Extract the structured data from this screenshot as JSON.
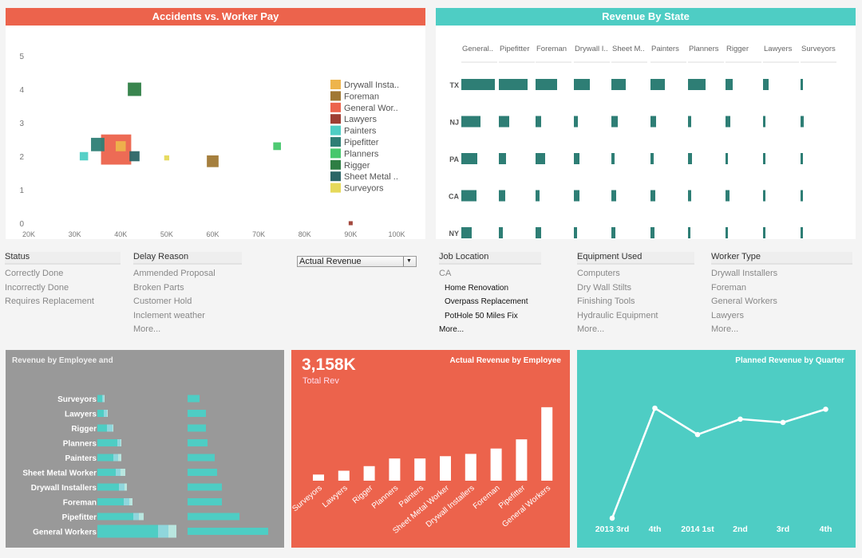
{
  "accidents": {
    "title": "Accidents vs. Worker Pay",
    "chart_data": {
      "type": "scatter",
      "title": "Accidents vs. Worker Pay",
      "xlabel": "",
      "ylabel": "",
      "xlim": [
        20000,
        100000
      ],
      "ylim": [
        0,
        5
      ],
      "x_ticks": [
        "20K",
        "30K",
        "40K",
        "50K",
        "60K",
        "70K",
        "80K",
        "90K",
        "100K"
      ],
      "y_ticks": [
        "0",
        "1",
        "2",
        "3",
        "4",
        "5"
      ],
      "legend_position": "right",
      "points": [
        {
          "name": "General Wor..",
          "x": 39000,
          "y": 2.2,
          "size": 9,
          "color": "#ec634c"
        },
        {
          "name": "Pipefitter",
          "x": 35000,
          "y": 2.35,
          "size": 4,
          "color": "#2e7e75"
        },
        {
          "name": "Painters",
          "x": 32000,
          "y": 2.0,
          "size": 2.5,
          "color": "#4ecdc4"
        },
        {
          "name": "Drywall Insta..",
          "x": 40000,
          "y": 2.3,
          "size": 3,
          "color": "#eeb44c"
        },
        {
          "name": "Sheet Metal ..",
          "x": 43000,
          "y": 2.0,
          "size": 3,
          "color": "#2b6566"
        },
        {
          "name": "Rigger",
          "x": 43000,
          "y": 4.0,
          "size": 4,
          "color": "#2e7e44"
        },
        {
          "name": "Surveyors",
          "x": 50000,
          "y": 1.95,
          "size": 1.5,
          "color": "#e6d95a"
        },
        {
          "name": "Foreman",
          "x": 60000,
          "y": 1.85,
          "size": 3.5,
          "color": "#a07833"
        },
        {
          "name": "Planners",
          "x": 74000,
          "y": 2.3,
          "size": 2.3,
          "color": "#46c76c"
        },
        {
          "name": "Lawyers",
          "x": 90000,
          "y": 0.0,
          "size": 1.2,
          "color": "#9e3e33"
        }
      ],
      "legend": [
        {
          "label": "Drywall Insta..",
          "color": "#eeb44c"
        },
        {
          "label": "Foreman",
          "color": "#a07833"
        },
        {
          "label": "General Wor..",
          "color": "#ec634c"
        },
        {
          "label": "Lawyers",
          "color": "#9e3e33"
        },
        {
          "label": "Painters",
          "color": "#4ecdc4"
        },
        {
          "label": "Pipefitter",
          "color": "#2e7e75"
        },
        {
          "label": "Planners",
          "color": "#46c76c"
        },
        {
          "label": "Rigger",
          "color": "#2e7e44"
        },
        {
          "label": "Sheet Metal ..",
          "color": "#2b6566"
        },
        {
          "label": "Surveyors",
          "color": "#e6d95a"
        }
      ]
    }
  },
  "state": {
    "title": "Revenue By State",
    "chart_data": {
      "type": "bar",
      "title": "Revenue By State",
      "columns": [
        "General..",
        "Pipefitter",
        "Foreman",
        "Drywall I..",
        "Sheet M..",
        "Painters",
        "Planners",
        "Rigger",
        "Lawyers",
        "Surveyors"
      ],
      "rows": [
        "TX",
        "NJ",
        "PA",
        "CA",
        "NY"
      ],
      "values": [
        [
          42,
          36,
          27,
          20,
          18,
          18,
          22,
          9,
          7,
          3
        ],
        [
          24,
          13,
          7,
          5,
          8,
          7,
          4,
          6,
          3,
          4
        ],
        [
          20,
          9,
          12,
          7,
          4,
          4,
          5,
          3,
          3,
          3
        ],
        [
          19,
          8,
          5,
          7,
          6,
          6,
          4,
          5,
          3,
          3
        ],
        [
          13,
          5,
          7,
          4,
          5,
          5,
          3,
          3,
          3,
          3
        ]
      ],
      "max": 42,
      "color": "#2e7e75"
    }
  },
  "filters": {
    "status": {
      "title": "Status",
      "items": [
        "Correctly Done",
        "Incorrectly Done",
        "Requires Replacement"
      ]
    },
    "delay": {
      "title": "Delay Reason",
      "items": [
        "Ammended Proposal",
        "Broken Parts",
        "Customer Hold",
        "Inclement weather"
      ],
      "more": "More..."
    },
    "select": {
      "value": "Actual Revenue",
      "arrow": "▼"
    },
    "location": {
      "title": "Job Location",
      "group": "CA",
      "items": [
        "Home Renovation",
        "Overpass Replacement",
        "PotHole 50 Miles Fix"
      ],
      "more": "More..."
    },
    "equipment": {
      "title": "Equipment Used",
      "items": [
        "Computers",
        "Dry Wall Stilts",
        "Finishing Tools",
        "Hydraulic Equipment"
      ],
      "more": "More..."
    },
    "worker": {
      "title": "Worker Type",
      "items": [
        "Drywall Installers",
        "Foreman",
        "General Workers",
        "Lawyers"
      ],
      "more": "More..."
    }
  },
  "employee": {
    "title": "Revenue by Employee and",
    "chart_data": {
      "type": "bar",
      "title": "Revenue by Employee and",
      "categories": [
        "Surveyors",
        "Lawyers",
        "Rigger",
        "Planners",
        "Painters",
        "Sheet Metal Worker",
        "Drywall Installers",
        "Foreman",
        "Pipefitter",
        "General Workers"
      ],
      "series": [
        {
          "name": "actual",
          "values": [
            6,
            8,
            12,
            25,
            20,
            23,
            27,
            33,
            45,
            76
          ],
          "color": "#4ecdc4"
        },
        {
          "name": "band1",
          "values": [
            2,
            4,
            7,
            4,
            6,
            6,
            7,
            7,
            7,
            13
          ],
          "color": "#8fd6dc"
        },
        {
          "name": "band2",
          "values": [
            1,
            1,
            1,
            1,
            4,
            6,
            3,
            4,
            6,
            10
          ],
          "color": "#b9e6df"
        },
        {
          "name": "right",
          "values": [
            15,
            23,
            23,
            25,
            34,
            37,
            43,
            43,
            65,
            101
          ],
          "color": "#4ecdc4"
        }
      ],
      "max": 101
    }
  },
  "actual": {
    "kpi": "3,158K",
    "kpi_label": "Total Rev",
    "title": "Actual Revenue by Employee",
    "chart_data": {
      "type": "bar",
      "title": "Actual Revenue by Employee",
      "categories": [
        "Surveyors",
        "Lawyers",
        "Rigger",
        "Planners",
        "Painters",
        "Sheet Metal Worker",
        "Drywall Installers",
        "Foreman",
        "Pipefitter",
        "General Workers"
      ],
      "values": [
        8,
        13,
        19,
        29,
        29,
        32,
        35,
        42,
        54,
        96
      ],
      "ylim": [
        0,
        100
      ],
      "color": "#ffffff"
    }
  },
  "planned": {
    "title": "Planned Revenue by Quarter",
    "chart_data": {
      "type": "line",
      "title": "Planned Revenue by Quarter",
      "categories": [
        "2013 3rd",
        "4th",
        "2014 1st",
        "2nd",
        "3rd",
        "4th"
      ],
      "values": [
        0,
        100,
        76,
        90,
        87,
        99
      ],
      "ylim": [
        0,
        100
      ],
      "color": "#ffffff"
    }
  }
}
